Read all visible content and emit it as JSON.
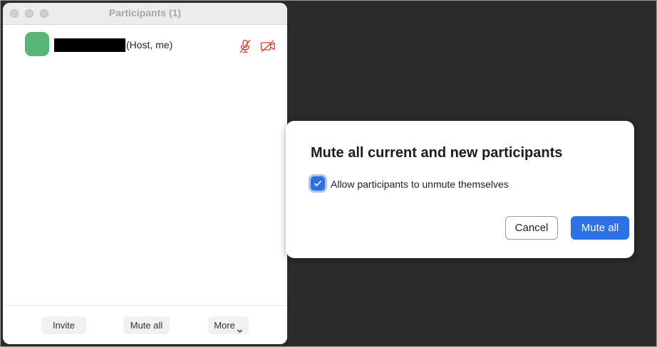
{
  "window": {
    "title": "Participants (1)"
  },
  "participants": [
    {
      "tag": "(Host, me)",
      "avatar_color": "#58b776",
      "mic_icon": "mic-muted-icon",
      "video_icon": "video-off-icon"
    }
  ],
  "toolbar": {
    "invite_label": "Invite",
    "mute_all_label": "Mute all",
    "more_label": "More"
  },
  "dialog": {
    "title": "Mute all current and new participants",
    "checkbox_label": "Allow participants to unmute themselves",
    "checkbox_checked": true,
    "cancel_label": "Cancel",
    "confirm_label": "Mute all"
  },
  "colors": {
    "accent": "#2d72e5",
    "muted_red": "#d93a2b",
    "background": "#2b2b2b"
  }
}
